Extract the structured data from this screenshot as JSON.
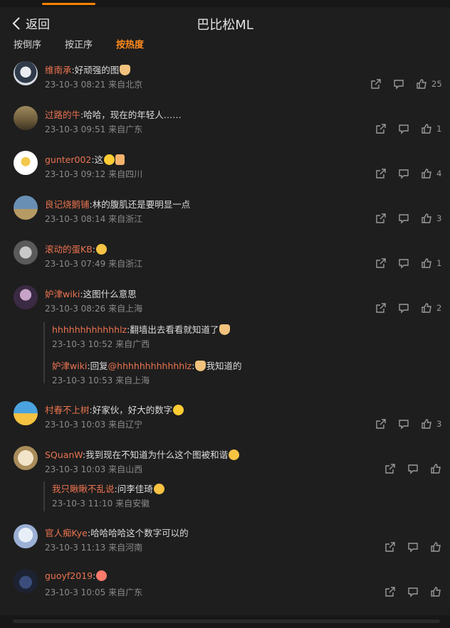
{
  "header": {
    "back_label": "返回",
    "title": "巴比松ML"
  },
  "sort": {
    "reverse": "按倒序",
    "forward": "按正序",
    "hot": "按热度"
  },
  "colors": {
    "accent": "#ff8200",
    "username": "#eb7350",
    "background": "#1e1e1e"
  },
  "comments": [
    {
      "user": "维南承",
      "text": ":好顽强的图",
      "emoji": "cat-emoji",
      "time": "23-10-3 08:21",
      "location": "来自北京",
      "likes": "25"
    },
    {
      "user": "过路的牛",
      "text": ":哈哈，现在的年轻人……",
      "emoji": "",
      "time": "23-10-3 09:51",
      "location": "来自广东",
      "likes": "1"
    },
    {
      "user": "gunter002",
      "text": ":这",
      "emoji": "smile-thumb-emoji",
      "time": "23-10-3 09:12",
      "location": "来自四川",
      "likes": "4"
    },
    {
      "user": "良记烧鹅铺",
      "text": ":林的腹肌还是要明显一点",
      "emoji": "",
      "time": "23-10-3 08:14",
      "location": "来自浙江",
      "likes": "3"
    },
    {
      "user": "滚动的蛋KB",
      "text": ":",
      "emoji": "laugh-emoji",
      "time": "23-10-3 07:49",
      "location": "来自浙江",
      "likes": "1"
    },
    {
      "user": "妒津wiki",
      "text": ":这图什么意思",
      "emoji": "",
      "time": "23-10-3 08:26",
      "location": "来自上海",
      "likes": "2"
    },
    {
      "user": "村春不上树",
      "text": ":好家伙，好大的数字",
      "emoji": "grin-emoji",
      "time": "23-10-3 10:03",
      "location": "来自辽宁",
      "likes": "3"
    },
    {
      "user": "SQuanW",
      "text": ":我到现在不知道为什么这个图被和谐",
      "emoji": "laugh-emoji",
      "time": "23-10-3 10:03",
      "location": "来自山西",
      "likes": ""
    },
    {
      "user": "官人痴Kye",
      "text": ":哈哈哈哈这个数字可以的",
      "emoji": "",
      "time": "23-10-3 11:13",
      "location": "来自河南",
      "likes": ""
    },
    {
      "user": "guoyf2019",
      "text": ":",
      "emoji": "kiss-emoji",
      "time": "23-10-3 10:05",
      "location": "来自广东",
      "likes": ""
    }
  ],
  "replies": [
    {
      "user": "hhhhhhhhhhhhlz",
      "text": ":翻墙出去看看就知道了",
      "emoji": "cat-emoji",
      "time": "23-10-3 10:52",
      "location": "来自广西"
    },
    {
      "user": "妒津wiki",
      "text": ":回复",
      "mention": "@hhhhhhhhhhhhlz",
      "text2": ":",
      "text3": "我知道的",
      "emoji": "cat-emoji",
      "time": "23-10-3 10:53",
      "location": "来自上海"
    },
    {
      "user": "我只瞅瞅不乱说",
      "text": ":问李佳琦",
      "emoji": "laugh-emoji",
      "time": "23-10-3 11:10",
      "location": "来自安徽"
    }
  ]
}
